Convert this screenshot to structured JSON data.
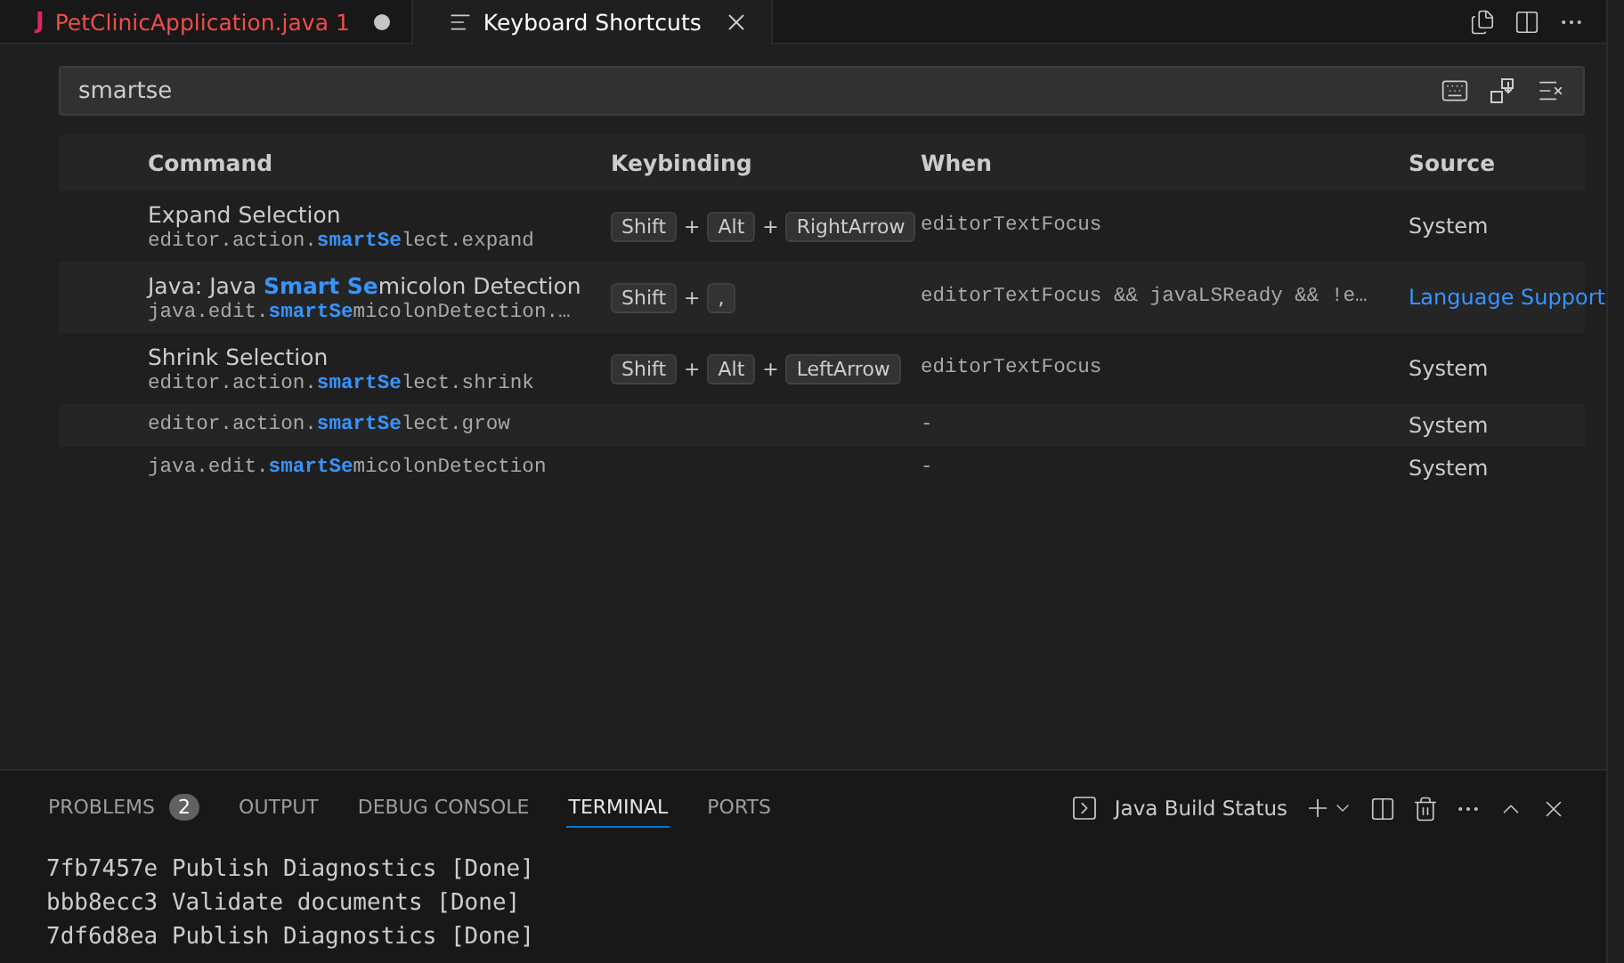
{
  "editor_tabs": [
    {
      "kind": "java",
      "title": "PetClinicApplication.java 1",
      "icon_letter": "J",
      "selected": false,
      "dirty": true
    },
    {
      "kind": "shortcuts",
      "title": "Keyboard Shortcuts",
      "selected": true,
      "dirty": false
    }
  ],
  "search": {
    "value": "smartse"
  },
  "table": {
    "columns": [
      "Command",
      "Keybinding",
      "When",
      "Source"
    ],
    "rows": [
      {
        "kind": "labeled",
        "label": "Expand Selection",
        "command": "editor.action.**smartSe**lect.expand",
        "keybinding": [
          {
            "kind": "key",
            "text": "Shift"
          },
          {
            "kind": "sep",
            "text": "+"
          },
          {
            "kind": "key",
            "text": "Alt"
          },
          {
            "kind": "sep",
            "text": "+"
          },
          {
            "kind": "key",
            "text": "RightArrow"
          }
        ],
        "when": "editorTextFocus",
        "source": "System",
        "source_link": false
      },
      {
        "kind": "labeled",
        "label": "Java: Java **Smart Se**micolon Detection",
        "command": "java.edit.**smartSe**micolonDetection.…",
        "keybinding": [
          {
            "kind": "key",
            "text": "Shift"
          },
          {
            "kind": "sep",
            "text": "+"
          },
          {
            "kind": "key",
            "text": ","
          }
        ],
        "when": "editorTextFocus && javaLSReady && !e…",
        "source": "Language Support",
        "source_link": true
      },
      {
        "kind": "labeled",
        "label": "Shrink Selection",
        "command": "editor.action.**smartSe**lect.shrink",
        "keybinding": [
          {
            "kind": "key",
            "text": "Shift"
          },
          {
            "kind": "sep",
            "text": "+"
          },
          {
            "kind": "key",
            "text": "Alt"
          },
          {
            "kind": "sep",
            "text": "+"
          },
          {
            "kind": "key",
            "text": "LeftArrow"
          }
        ],
        "when": "editorTextFocus",
        "source": "System",
        "source_link": false
      },
      {
        "kind": "id-only",
        "command": "editor.action.**smartSe**lect.grow",
        "keybinding": [],
        "when": "-",
        "source": "System",
        "source_link": false
      },
      {
        "kind": "id-only",
        "command": "java.edit.**smartSe**micolonDetection",
        "keybinding": [],
        "when": "-",
        "source": "System",
        "source_link": false
      }
    ]
  },
  "panel": {
    "tabs": [
      {
        "label": "PROBLEMS",
        "badge": "2",
        "selected": false
      },
      {
        "label": "OUTPUT",
        "selected": false
      },
      {
        "label": "DEBUG CONSOLE",
        "selected": false
      },
      {
        "label": "TERMINAL",
        "selected": true
      },
      {
        "label": "PORTS",
        "selected": false
      }
    ],
    "terminal_name": "Java Build Status",
    "terminal_lines": [
      "7fb7457e Publish Diagnostics [Done]",
      "bbb8ecc3 Validate documents [Done]",
      "7df6d8ea Publish Diagnostics [Done]"
    ]
  }
}
